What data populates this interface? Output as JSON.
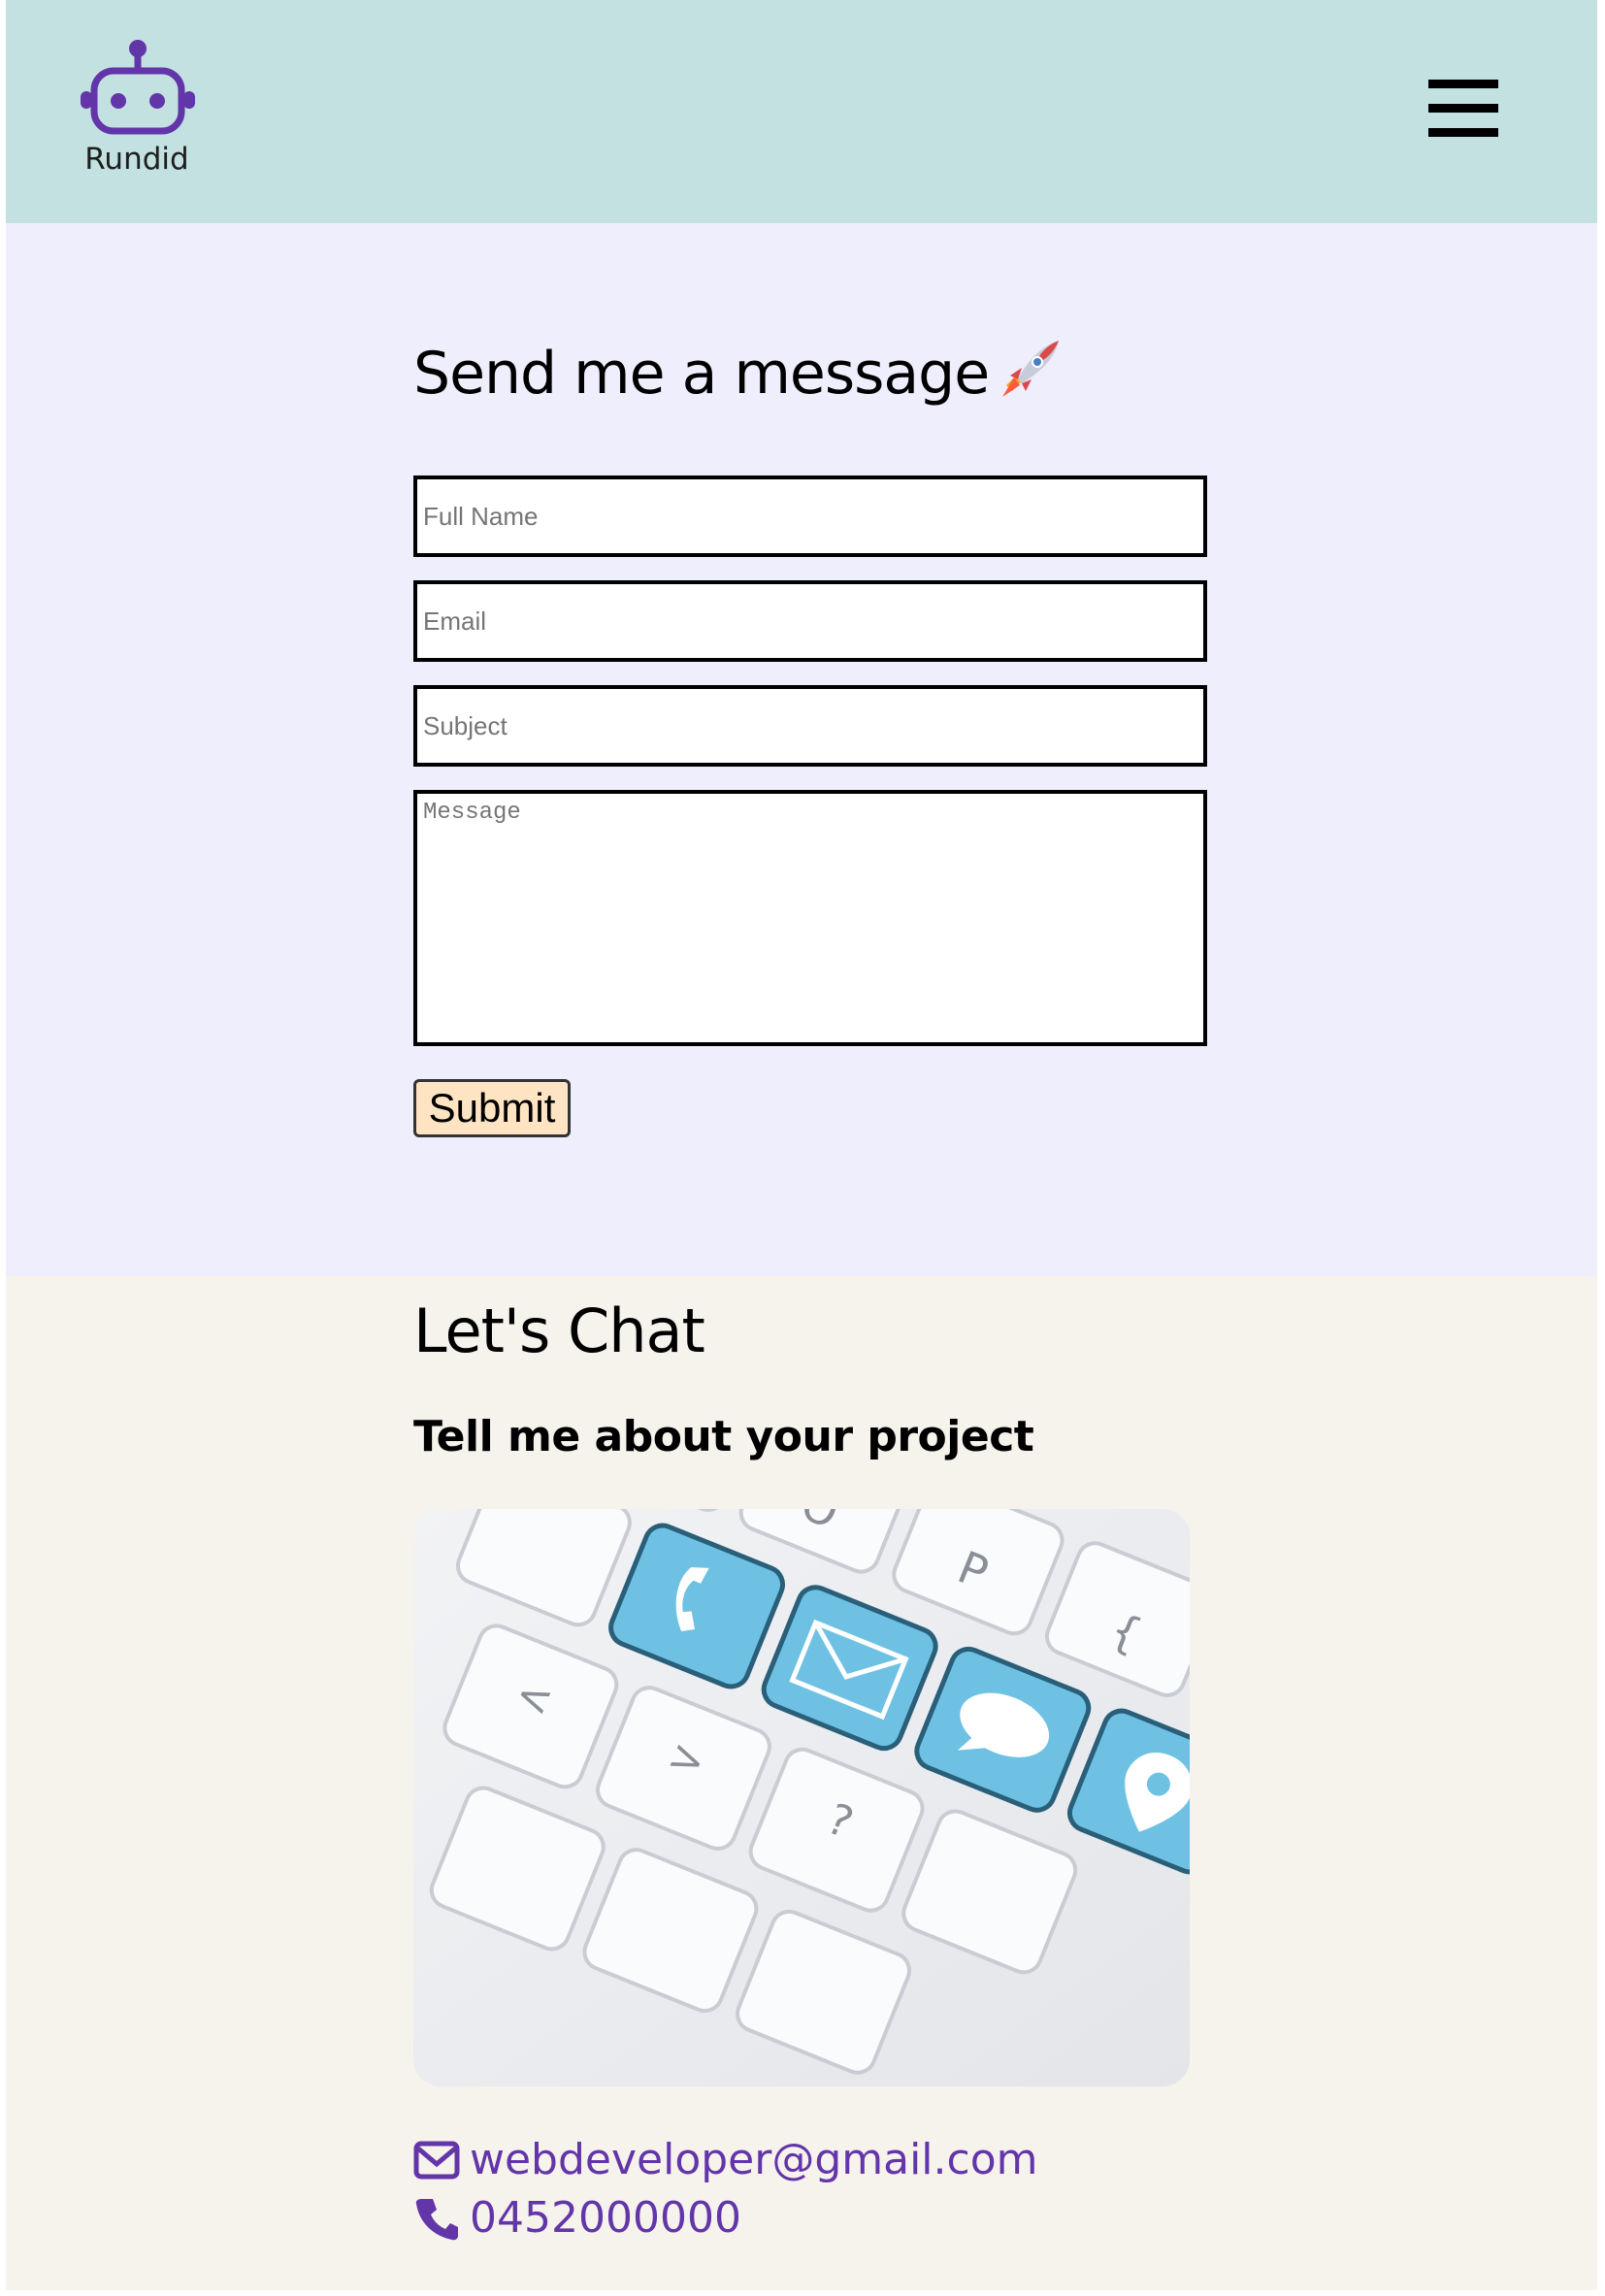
{
  "header": {
    "brand_name": "Rundid",
    "logo_icon": "robot-icon",
    "menu_icon": "hamburger-menu-icon",
    "background_color": "#c3e1e1"
  },
  "contact_form": {
    "title": "Send me a message",
    "title_emoji": "rocket-icon",
    "background_color": "#efeefc",
    "fields": {
      "full_name": {
        "placeholder": "Full Name",
        "value": ""
      },
      "email": {
        "placeholder": "Email",
        "value": ""
      },
      "subject": {
        "placeholder": "Subject",
        "value": ""
      },
      "message": {
        "placeholder": "Message",
        "value": ""
      }
    },
    "submit_label": "Submit",
    "submit_color": "#ffe4c4"
  },
  "chat": {
    "title": "Let's Chat",
    "subtitle": "Tell me about your project",
    "image_icon": "keyboard-contact-keys-image",
    "background_color": "#f6f2ec",
    "email": "webdeveloper@gmail.com",
    "email_icon": "envelope-icon",
    "phone": "0452000000",
    "phone_icon": "phone-icon",
    "accent_color": "#6235a9"
  }
}
